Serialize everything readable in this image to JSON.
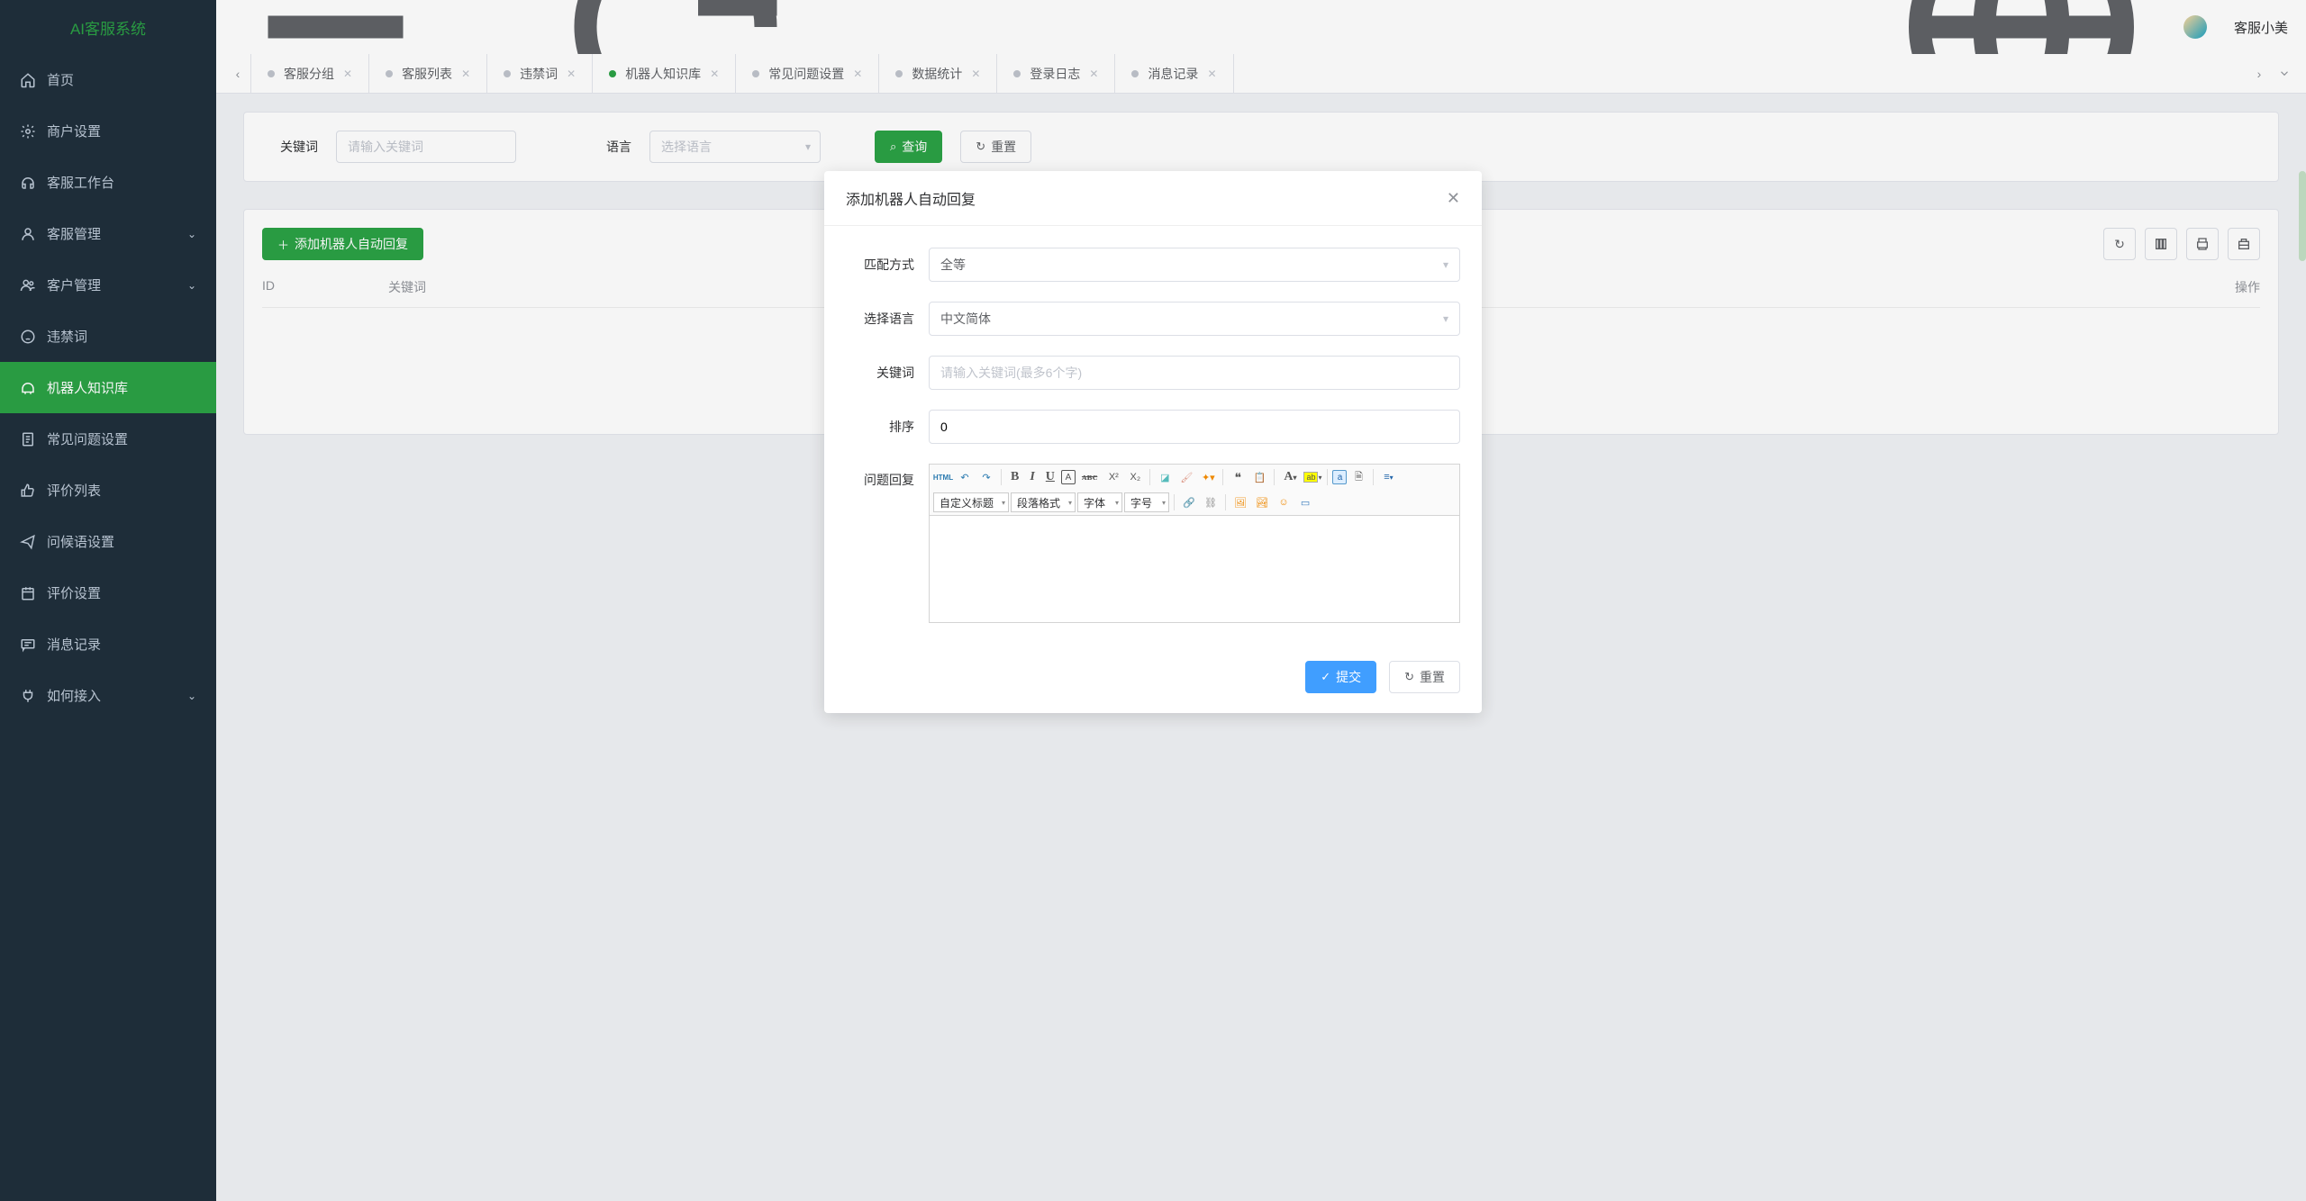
{
  "app": {
    "logo": "AI客服系统"
  },
  "sidebar": {
    "items": [
      {
        "label": "首页",
        "icon": "home",
        "expandable": false
      },
      {
        "label": "商户设置",
        "icon": "gear",
        "expandable": false
      },
      {
        "label": "客服工作台",
        "icon": "headset",
        "expandable": false
      },
      {
        "label": "客服管理",
        "icon": "user",
        "expandable": true
      },
      {
        "label": "客户管理",
        "icon": "users",
        "expandable": true
      },
      {
        "label": "违禁词",
        "icon": "ban",
        "expandable": false
      },
      {
        "label": "机器人知识库",
        "icon": "robot",
        "expandable": false,
        "active": true
      },
      {
        "label": "常见问题设置",
        "icon": "doc",
        "expandable": false
      },
      {
        "label": "评价列表",
        "icon": "thumb",
        "expandable": false
      },
      {
        "label": "问候语设置",
        "icon": "send",
        "expandable": false
      },
      {
        "label": "评价设置",
        "icon": "cal",
        "expandable": false
      },
      {
        "label": "消息记录",
        "icon": "msg",
        "expandable": false
      },
      {
        "label": "如何接入",
        "icon": "plug",
        "expandable": true
      }
    ]
  },
  "topbar": {
    "username": "客服小美"
  },
  "tabs": {
    "items": [
      {
        "label": "客服分组"
      },
      {
        "label": "客服列表"
      },
      {
        "label": "违禁词"
      },
      {
        "label": "机器人知识库",
        "active": true
      },
      {
        "label": "常见问题设置"
      },
      {
        "label": "数据统计"
      },
      {
        "label": "登录日志"
      },
      {
        "label": "消息记录"
      }
    ]
  },
  "search": {
    "keyword_label": "关键词",
    "keyword_placeholder": "请输入关键词",
    "lang_label": "语言",
    "lang_placeholder": "选择语言",
    "query_btn": "查询",
    "reset_btn": "重置"
  },
  "panel": {
    "add_btn": "添加机器人自动回复",
    "columns": {
      "id": "ID",
      "keyword": "关键词",
      "op": "操作"
    }
  },
  "dialog": {
    "title": "添加机器人自动回复",
    "fields": {
      "match_type": {
        "label": "匹配方式",
        "value": "全等"
      },
      "language": {
        "label": "选择语言",
        "value": "中文简体"
      },
      "keyword": {
        "label": "关键词",
        "placeholder": "请输入关键词(最多6个字)",
        "value": ""
      },
      "sort": {
        "label": "排序",
        "value": "0"
      },
      "reply": {
        "label": "问题回复"
      }
    },
    "editor": {
      "dropdowns": {
        "custom_title": "自定义标题",
        "paragraph": "段落格式",
        "font": "字体",
        "size": "字号"
      },
      "html_btn": "HTML"
    },
    "submit_btn": "提交",
    "reset_btn": "重置"
  }
}
